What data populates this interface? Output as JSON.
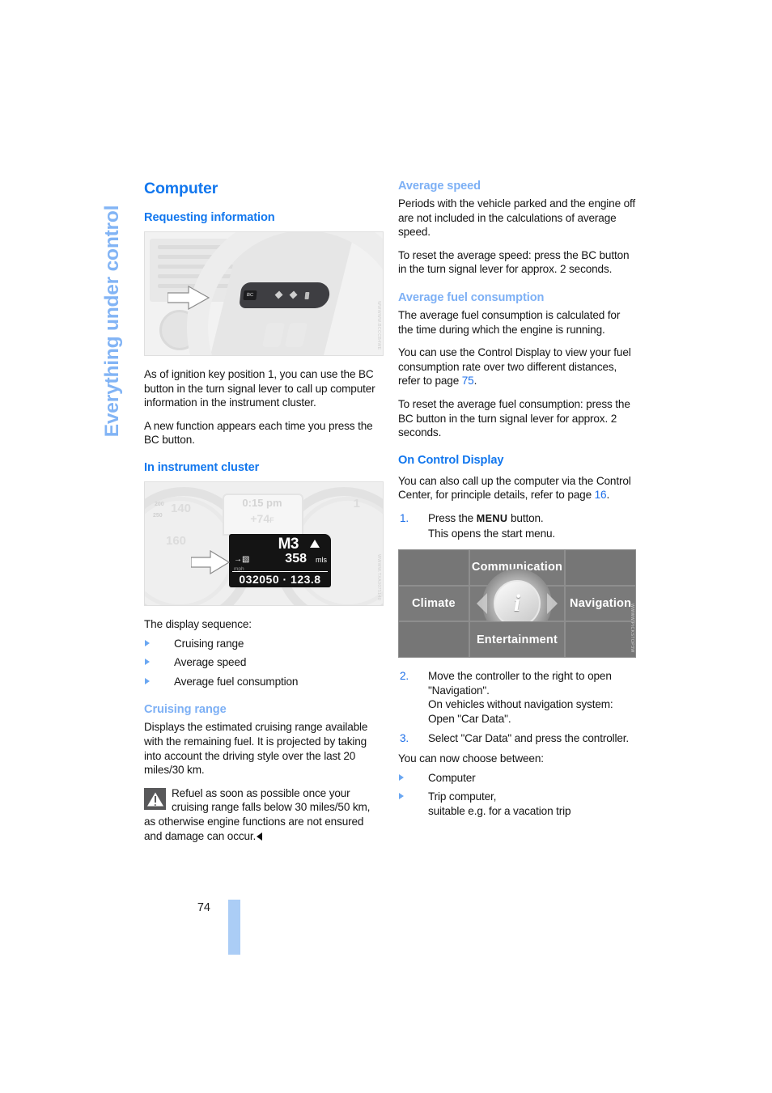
{
  "chapter_tab": {
    "label": "Everything under control"
  },
  "page": {
    "number": "74"
  },
  "left_column": {
    "section_title": "Computer",
    "requesting": {
      "heading": "Requesting information",
      "figure": {
        "name": "turn-signal-lever-bc-button",
        "credit": "WWWWW.BCCCB4WE",
        "lever_button_label": "BC"
      },
      "paragraphs": [
        "As of ignition key position 1, you can use the BC button in the turn signal lever to call up computer information in the instrument cluster.",
        "A new function appears each time you press the BC button."
      ]
    },
    "instrument_cluster": {
      "heading": "In instrument cluster",
      "figure": {
        "name": "instrument-cluster-display",
        "credit": "WWWW.TXA0075140",
        "clock": "0:15 pm",
        "temperature": "+74",
        "temperature_unit": "F",
        "gear": "M3",
        "range_value": "358",
        "range_unit": "mls",
        "mph_label": "mph",
        "odometer": "032050 · 123.8",
        "speed_ticks": [
          "200",
          "250",
          "140",
          "160"
        ],
        "rpm_tick": "1"
      },
      "sequence_intro": "The display sequence:",
      "sequence": [
        "Cruising range",
        "Average speed",
        "Average fuel consumption"
      ]
    },
    "cruising_range": {
      "heading": "Cruising range",
      "paragraph": "Displays the estimated cruising range available with the remaining fuel. It is projected by taking into account the driving style over the last 20 miles/30 km.",
      "note": "Refuel as soon as possible once your cruising range falls below 30 miles/50 km, as otherwise engine functions are not ensured and damage can occur."
    }
  },
  "right_column": {
    "average_speed": {
      "heading": "Average speed",
      "paragraphs": [
        "Periods with the vehicle parked and the engine off are not included in the calculations of average speed.",
        "To reset the average speed: press the BC button in the turn signal lever for approx. 2 seconds."
      ]
    },
    "average_fuel": {
      "heading": "Average fuel consumption",
      "paragraph_1": "The average fuel consumption is calculated for the time during which the engine is running.",
      "paragraph_2_pre": "You can use the Control Display to view your fuel consumption rate over two different distances, refer to page ",
      "paragraph_2_link": "75",
      "paragraph_2_post": ".",
      "paragraph_3": "To reset the average fuel consumption: press the BC button in the turn signal lever for approx. 2 seconds."
    },
    "control_display": {
      "heading": "On Control Display",
      "intro_pre": "You can also call up the computer via the Control Center, for principle details, refer to page ",
      "intro_link": "16",
      "intro_post": ".",
      "step_1": {
        "number": "1.",
        "text_pre": "Press the ",
        "key": "MENU",
        "text_post": " button.",
        "text_line2": "This opens the start menu."
      },
      "figure": {
        "name": "start-menu-control-display",
        "credit": "WWWW.PICKSTOP3W",
        "center_icon": "i",
        "cells": {
          "top": "Communication",
          "left": "Climate",
          "right": "Navigation",
          "bottom": "Entertainment"
        }
      },
      "step_2": {
        "number": "2.",
        "lines": [
          "Move the controller to the right to open \"Navigation\".",
          "On vehicles without navigation system:",
          "Open \"Car Data\"."
        ]
      },
      "step_3": {
        "number": "3.",
        "text": "Select \"Car Data\" and press the controller."
      },
      "choose_intro": "You can now choose between:",
      "choices": [
        "Computer",
        "Trip computer,\nsuitable e.g. for a vacation trip"
      ]
    }
  },
  "colors": {
    "heading_blue": "#1277ee",
    "subheading_light_blue": "#7db0f5",
    "link_blue": "#1d6fe8",
    "tab_blue": "#abcdf6",
    "chapter_tab_blue": "#82b4f5"
  }
}
